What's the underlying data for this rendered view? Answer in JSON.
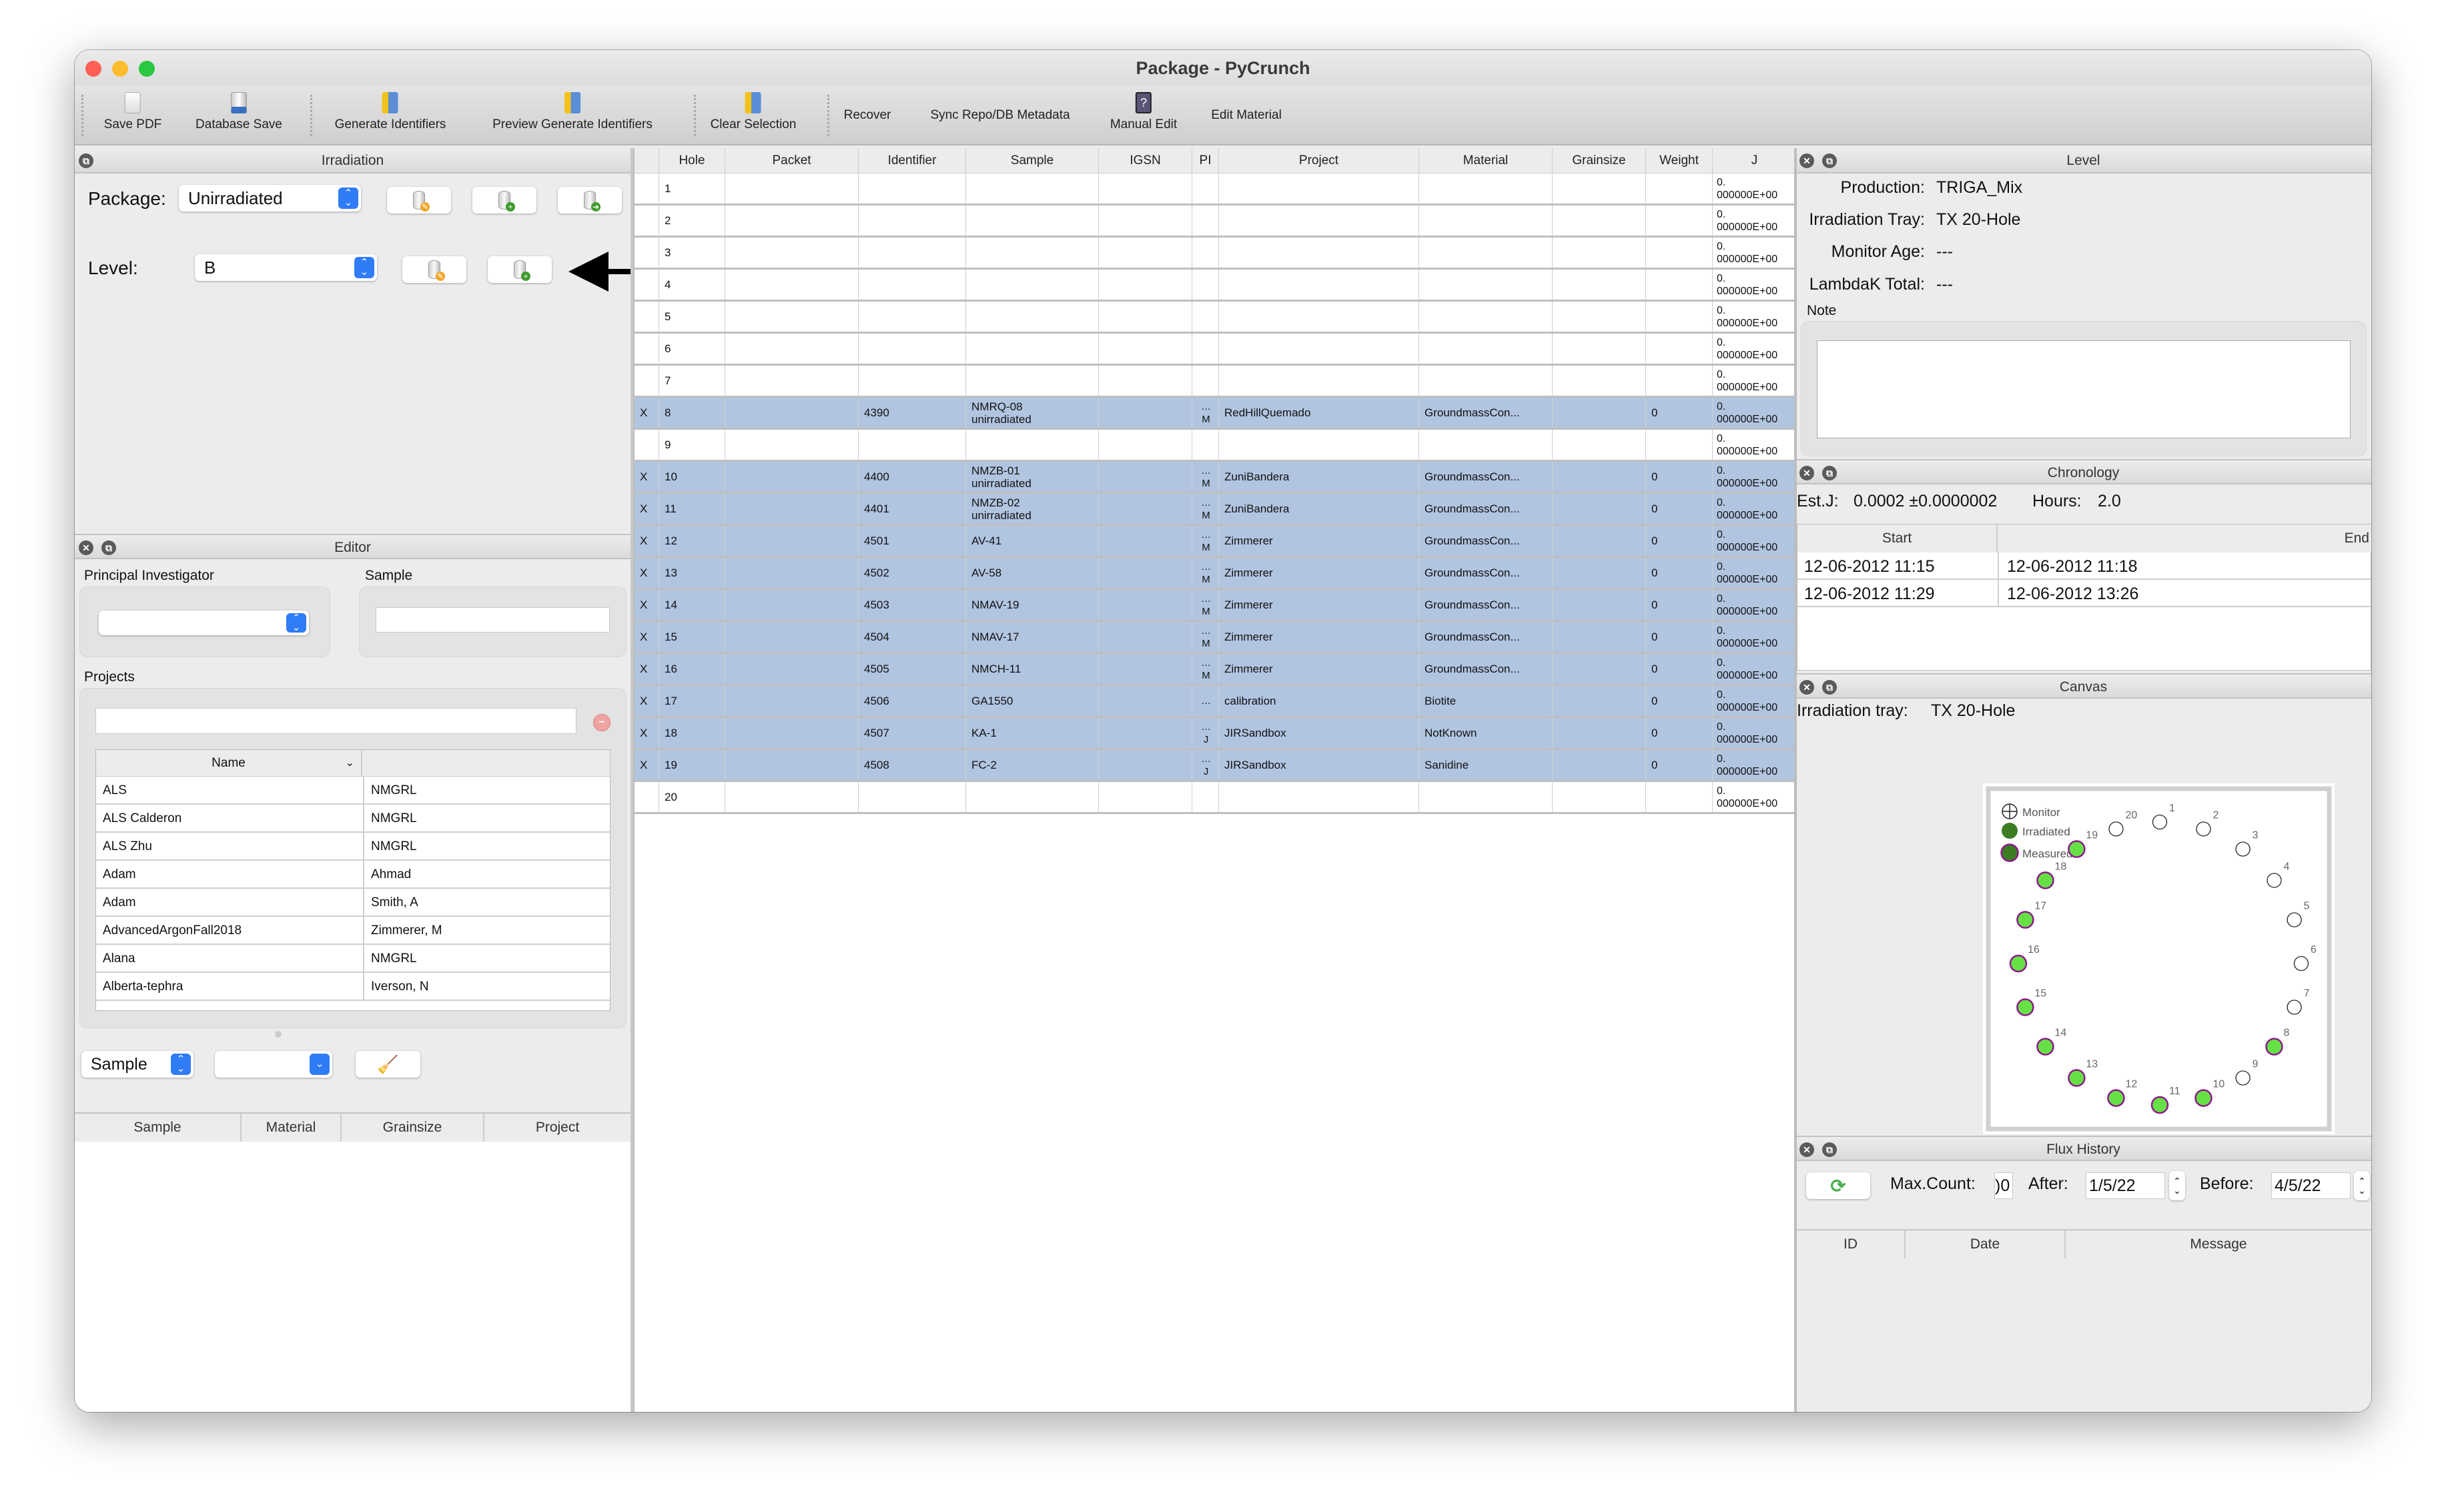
{
  "window": {
    "title": "Package - PyCrunch"
  },
  "toolbar": {
    "save_pdf": "Save PDF",
    "database_save": "Database Save",
    "generate_identifiers": "Generate Identifiers",
    "preview_generate_identifiers": "Preview Generate Identifiers",
    "clear_selection": "Clear Selection",
    "recover": "Recover",
    "sync_metadata": "Sync Repo/DB Metadata",
    "manual_edit": "Manual Edit",
    "edit_material": "Edit Material"
  },
  "irradiation": {
    "title": "Irradiation",
    "package_label": "Package:",
    "package_value": "Unirradiated",
    "level_label": "Level:",
    "level_value": "B"
  },
  "editor": {
    "title": "Editor",
    "pi_label": "Principal Investigator",
    "sample_label": "Sample",
    "projects_label": "Projects",
    "projects_columns": [
      "Name",
      ""
    ],
    "projects": [
      [
        "ALS",
        "NMGRL"
      ],
      [
        "ALS Calderon",
        "NMGRL"
      ],
      [
        "ALS Zhu",
        "NMGRL"
      ],
      [
        "Adam",
        "Ahmad"
      ],
      [
        "Adam",
        "Smith, A"
      ],
      [
        "AdvancedArgonFall2018",
        "Zimmerer, M"
      ],
      [
        "Alana",
        "NMGRL"
      ],
      [
        "Alberta-tephra",
        "Iverson, N"
      ]
    ],
    "filter_attr": "Sample",
    "sample_table_columns": [
      "Sample",
      "Material",
      "Grainsize",
      "Project"
    ]
  },
  "positions": {
    "columns": [
      "",
      "Hole",
      "Packet",
      "Identifier",
      "Sample",
      "IGSN",
      "PI",
      "Project",
      "Material",
      "Grainsize",
      "Weight",
      "J"
    ],
    "rows": [
      {
        "sel": "",
        "hole": "1",
        "packet": "",
        "identifier": "",
        "sample": "",
        "igsn": "",
        "pi": "",
        "project": "",
        "material": "",
        "grainsize": "",
        "weight": "",
        "j": "0.\n000000E+00"
      },
      {
        "sel": "",
        "hole": "2",
        "packet": "",
        "identifier": "",
        "sample": "",
        "igsn": "",
        "pi": "",
        "project": "",
        "material": "",
        "grainsize": "",
        "weight": "",
        "j": "0.\n000000E+00"
      },
      {
        "sel": "",
        "hole": "3",
        "packet": "",
        "identifier": "",
        "sample": "",
        "igsn": "",
        "pi": "",
        "project": "",
        "material": "",
        "grainsize": "",
        "weight": "",
        "j": "0.\n000000E+00"
      },
      {
        "sel": "",
        "hole": "4",
        "packet": "",
        "identifier": "",
        "sample": "",
        "igsn": "",
        "pi": "",
        "project": "",
        "material": "",
        "grainsize": "",
        "weight": "",
        "j": "0.\n000000E+00"
      },
      {
        "sel": "",
        "hole": "5",
        "packet": "",
        "identifier": "",
        "sample": "",
        "igsn": "",
        "pi": "",
        "project": "",
        "material": "",
        "grainsize": "",
        "weight": "",
        "j": "0.\n000000E+00"
      },
      {
        "sel": "",
        "hole": "6",
        "packet": "",
        "identifier": "",
        "sample": "",
        "igsn": "",
        "pi": "",
        "project": "",
        "material": "",
        "grainsize": "",
        "weight": "",
        "j": "0.\n000000E+00"
      },
      {
        "sel": "",
        "hole": "7",
        "packet": "",
        "identifier": "",
        "sample": "",
        "igsn": "",
        "pi": "",
        "project": "",
        "material": "",
        "grainsize": "",
        "weight": "",
        "j": "0.\n000000E+00"
      },
      {
        "sel": "X",
        "hole": "8",
        "packet": "",
        "identifier": "4390",
        "sample": "NMRQ-08\nunirradiated",
        "igsn": "",
        "pi": "…\nM",
        "project": "RedHillQuemado",
        "material": "GroundmassCon...",
        "grainsize": "",
        "weight": "0",
        "j": "0.\n000000E+00"
      },
      {
        "sel": "",
        "hole": "9",
        "packet": "",
        "identifier": "",
        "sample": "",
        "igsn": "",
        "pi": "",
        "project": "",
        "material": "",
        "grainsize": "",
        "weight": "",
        "j": "0.\n000000E+00"
      },
      {
        "sel": "X",
        "hole": "10",
        "packet": "",
        "identifier": "4400",
        "sample": "NMZB-01\nunirradiated",
        "igsn": "",
        "pi": "…\nM",
        "project": "ZuniBandera",
        "material": "GroundmassCon...",
        "grainsize": "",
        "weight": "0",
        "j": "0.\n000000E+00"
      },
      {
        "sel": "X",
        "hole": "11",
        "packet": "",
        "identifier": "4401",
        "sample": "NMZB-02\nunirradiated",
        "igsn": "",
        "pi": "…\nM",
        "project": "ZuniBandera",
        "material": "GroundmassCon...",
        "grainsize": "",
        "weight": "0",
        "j": "0.\n000000E+00"
      },
      {
        "sel": "X",
        "hole": "12",
        "packet": "",
        "identifier": "4501",
        "sample": "AV-41",
        "igsn": "",
        "pi": "…\nM",
        "project": "Zimmerer",
        "material": "GroundmassCon...",
        "grainsize": "",
        "weight": "0",
        "j": "0.\n000000E+00"
      },
      {
        "sel": "X",
        "hole": "13",
        "packet": "",
        "identifier": "4502",
        "sample": "AV-58",
        "igsn": "",
        "pi": "…\nM",
        "project": "Zimmerer",
        "material": "GroundmassCon...",
        "grainsize": "",
        "weight": "0",
        "j": "0.\n000000E+00"
      },
      {
        "sel": "X",
        "hole": "14",
        "packet": "",
        "identifier": "4503",
        "sample": "NMAV-19",
        "igsn": "",
        "pi": "…\nM",
        "project": "Zimmerer",
        "material": "GroundmassCon...",
        "grainsize": "",
        "weight": "0",
        "j": "0.\n000000E+00"
      },
      {
        "sel": "X",
        "hole": "15",
        "packet": "",
        "identifier": "4504",
        "sample": "NMAV-17",
        "igsn": "",
        "pi": "…\nM",
        "project": "Zimmerer",
        "material": "GroundmassCon...",
        "grainsize": "",
        "weight": "0",
        "j": "0.\n000000E+00"
      },
      {
        "sel": "X",
        "hole": "16",
        "packet": "",
        "identifier": "4505",
        "sample": "NMCH-11",
        "igsn": "",
        "pi": "…\nM",
        "project": "Zimmerer",
        "material": "GroundmassCon...",
        "grainsize": "",
        "weight": "0",
        "j": "0.\n000000E+00"
      },
      {
        "sel": "X",
        "hole": "17",
        "packet": "",
        "identifier": "4506",
        "sample": "GA1550",
        "igsn": "",
        "pi": "…",
        "project": "calibration",
        "material": "Biotite",
        "grainsize": "",
        "weight": "0",
        "j": "0.\n000000E+00"
      },
      {
        "sel": "X",
        "hole": "18",
        "packet": "",
        "identifier": "4507",
        "sample": "KA-1",
        "igsn": "",
        "pi": "…\nJ",
        "project": "JIRSandbox",
        "material": "NotKnown",
        "grainsize": "",
        "weight": "0",
        "j": "0.\n000000E+00"
      },
      {
        "sel": "X",
        "hole": "19",
        "packet": "",
        "identifier": "4508",
        "sample": "FC-2",
        "igsn": "",
        "pi": "…\nJ",
        "project": "JIRSandbox",
        "material": "Sanidine",
        "grainsize": "",
        "weight": "0",
        "j": "0.\n000000E+00"
      },
      {
        "sel": "",
        "hole": "20",
        "packet": "",
        "identifier": "",
        "sample": "",
        "igsn": "",
        "pi": "",
        "project": "",
        "material": "",
        "grainsize": "",
        "weight": "",
        "j": "0.\n000000E+00"
      }
    ]
  },
  "level": {
    "title": "Level",
    "production_label": "Production:",
    "production": "TRIGA_Mix",
    "tray_label": "Irradiation Tray:",
    "tray": "TX 20-Hole",
    "monitor_age_label": "Monitor Age:",
    "monitor_age": "---",
    "lambdak_label": "LambdaK Total:",
    "lambdak": "---",
    "note_label": "Note"
  },
  "chronology": {
    "title": "Chronology",
    "estj_label": "Est.J:",
    "estj": "0.0002 ±0.0000002",
    "hours_label": "Hours:",
    "hours": "2.0",
    "columns": [
      "Start",
      "End"
    ],
    "rows": [
      [
        "12-06-2012 11:15",
        "12-06-2012 11:18"
      ],
      [
        "12-06-2012 11:29",
        "12-06-2012 13:26"
      ]
    ]
  },
  "canvas": {
    "title": "Canvas",
    "tray_label": "Irradiation tray:",
    "tray": "TX 20-Hole",
    "legend": [
      "Monitor",
      "Irradiated",
      "Measured"
    ],
    "colors": {
      "filled": "#66e045",
      "measured_ring": "#8b1a8b",
      "irradiated": "#3a7d22"
    },
    "holes": [
      {
        "n": "1",
        "filled": false
      },
      {
        "n": "2",
        "filled": false
      },
      {
        "n": "3",
        "filled": false
      },
      {
        "n": "4",
        "filled": false
      },
      {
        "n": "5",
        "filled": false
      },
      {
        "n": "6",
        "filled": false
      },
      {
        "n": "7",
        "filled": false
      },
      {
        "n": "8",
        "filled": true
      },
      {
        "n": "9",
        "filled": false
      },
      {
        "n": "10",
        "filled": true
      },
      {
        "n": "11",
        "filled": true
      },
      {
        "n": "12",
        "filled": true
      },
      {
        "n": "13",
        "filled": true
      },
      {
        "n": "14",
        "filled": true
      },
      {
        "n": "15",
        "filled": true
      },
      {
        "n": "16",
        "filled": true
      },
      {
        "n": "17",
        "filled": true
      },
      {
        "n": "18",
        "filled": true
      },
      {
        "n": "19",
        "filled": true
      },
      {
        "n": "20",
        "filled": false
      }
    ]
  },
  "flux": {
    "title": "Flux History",
    "max_count_label": "Max.Count:",
    "max_count": ")0",
    "after_label": "After:",
    "after": "1/5/22",
    "before_label": "Before:",
    "before": "4/5/22",
    "columns": [
      "ID",
      "Date",
      "Message"
    ]
  }
}
